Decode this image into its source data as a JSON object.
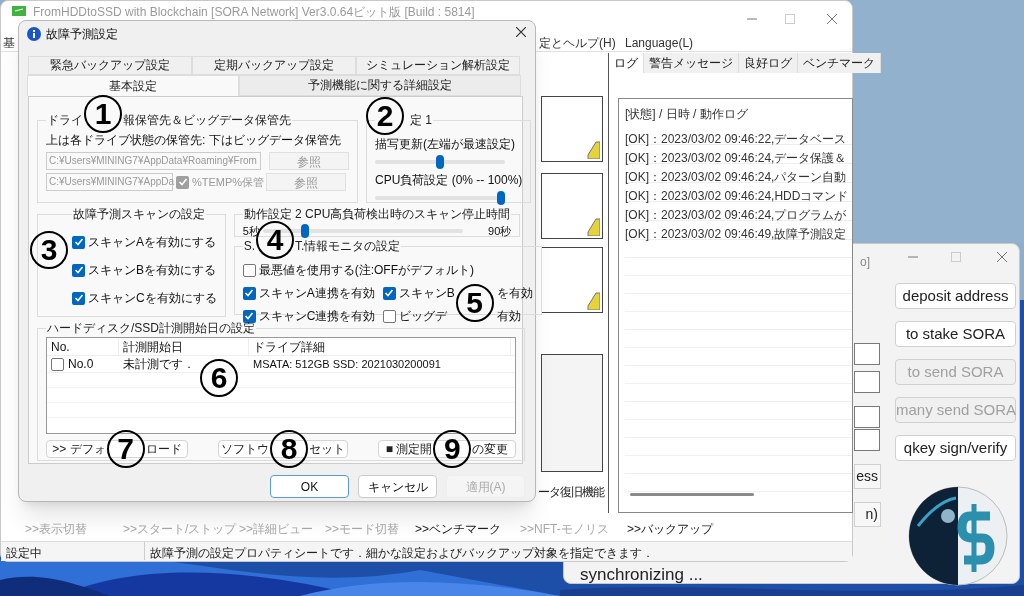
{
  "main_window": {
    "title": "FromHDDtoSSD with Blockchain [SORA Network] Ver3.0.64ビット版 [Build : 5814]",
    "menu": [
      "基",
      "定とヘルプ(H)",
      "Language(L)"
    ],
    "log_tabs": [
      {
        "label": "ログ",
        "selected": true
      },
      {
        "label": "警告メッセージ",
        "selected": false
      },
      {
        "label": "良好ログ",
        "selected": false
      },
      {
        "label": "ベンチマーク",
        "selected": false
      }
    ],
    "log_header": "[状態] / 日時 / 動作ログ",
    "log_lines": [
      "[OK]：2023/03/02 09:46:22,データベース",
      "[OK]：2023/03/02 09:46:24,データ保護＆",
      "[OK]：2023/03/02 09:46:24,パターン自動",
      "[OK]：2023/03/02 09:46:24,HDDコマンド",
      "[OK]：2023/03/02 09:46:24,プログラムが",
      "[OK]：2023/03/02 09:46:49,故障予測設定"
    ],
    "side_caption": "ータ復旧機能",
    "toolbar": [
      {
        "label": ">>表示切替",
        "disabled": true
      },
      {
        "label": ">>スタート/ストップ",
        "disabled": true
      },
      {
        "label": ">>詳細ビュー",
        "disabled": true
      },
      {
        "label": ">>モード切替",
        "disabled": true
      },
      {
        "label": ">>ベンチマーク",
        "disabled": false
      },
      {
        "label": ">>NFT-モノリス",
        "disabled": true
      },
      {
        "label": ">>バックアップ",
        "disabled": false
      }
    ],
    "status_bar": [
      "設定中",
      "故障予測の設定プロパティシートです．細かな設定およびバックアップ対象を指定できます．"
    ]
  },
  "wallet_window": {
    "title": "o]",
    "buttons": [
      {
        "label": "deposit address",
        "disabled": false
      },
      {
        "label": "to stake SORA",
        "disabled": false
      },
      {
        "label": "to send SORA",
        "disabled": true
      },
      {
        "label": "many send SORA",
        "disabled": true
      },
      {
        "label": "qkey sign/verify",
        "disabled": false
      }
    ],
    "partial_buttons": [
      "ess",
      "n)"
    ],
    "status": "synchronizing ..."
  },
  "dialog": {
    "title": "故障予測設定",
    "tabs_row_1": [
      {
        "label": "緊急バックアップ設定",
        "selected": false
      },
      {
        "label": "定期バックアップ設定",
        "selected": false
      },
      {
        "label": "シミュレーション解析設定",
        "selected": false
      }
    ],
    "tabs_row_2": [
      {
        "label": "基本設定",
        "selected": true
      },
      {
        "label": "予測機能に関する詳細設定",
        "selected": false
      }
    ],
    "storage": {
      "legend_parts": [
        "ドライ",
        "報保管先＆ビッグデータ保管先"
      ],
      "note": "上は各ドライブ状態の保管先: 下はビッグデータ保管先",
      "path_1": "C:¥Users¥MINING7¥AppData¥Roaming¥From",
      "browse_1": "参照",
      "path_2": "C:¥Users¥MINING7¥AppDa",
      "temp": {
        "label": "%TEMP%保管",
        "checked": true
      },
      "browse_2": "参照"
    },
    "operation_1": {
      "legend": "定 1",
      "sliders": [
        {
          "label": "描写更新(左端が最速設定)",
          "level": 0.5
        },
        {
          "label": "CPU負荷設定 (0% -- 100%)",
          "level": 1
        }
      ]
    },
    "scan": {
      "legend": "故障予測スキャンの設定",
      "options": [
        {
          "label": "スキャンAを有効にする",
          "checked": true
        },
        {
          "label": "スキャンBを有効にする",
          "checked": true
        },
        {
          "label": "スキャンCを有効にする",
          "checked": true
        }
      ]
    },
    "operation_2": {
      "legend": "動作設定 2 CPU高負荷検出時のスキャン停止時間",
      "min": "5秒",
      "max": "90秒",
      "level": 0.2
    },
    "smart": {
      "legend_parts": [
        "S.",
        "T.情報モニタの設定"
      ],
      "options": [
        {
          "label": "最悪値を使用する(注:OFFがデフォルト)",
          "checked": false
        },
        {
          "label": "スキャンA連携を有効",
          "checked": true
        },
        {
          "label_parts": [
            "スキャンB",
            "を有効"
          ],
          "checked": true
        },
        {
          "label": "スキャンC連携を有効",
          "checked": true
        },
        {
          "label_parts": [
            "ビッグデ",
            "有効"
          ],
          "checked": false
        }
      ]
    },
    "measure": {
      "legend": "ハードディスク/SSD計測開始日の設定",
      "columns": [
        "No.",
        "計測開始日",
        "ドライブ詳細"
      ],
      "rows": [
        {
          "no": "No.0",
          "checked": false,
          "date": "未計測です．",
          "detail": "MSATA: 512GB SSD: 2021030200091"
        }
      ],
      "buttons": [
        [
          ">> デフォ",
          "ロード"
        ],
        [
          "ソフトウ",
          "セット"
        ],
        [
          "■ 測定開",
          "の変更"
        ]
      ]
    },
    "buttons": [
      {
        "label": "OK",
        "disabled": false
      },
      {
        "label": "キャンセル",
        "disabled": false
      },
      {
        "label": "適用(A)",
        "disabled": true
      }
    ]
  },
  "annotations": [
    "1",
    "2",
    "3",
    "4",
    "5",
    "6",
    "7",
    "8",
    "9"
  ]
}
